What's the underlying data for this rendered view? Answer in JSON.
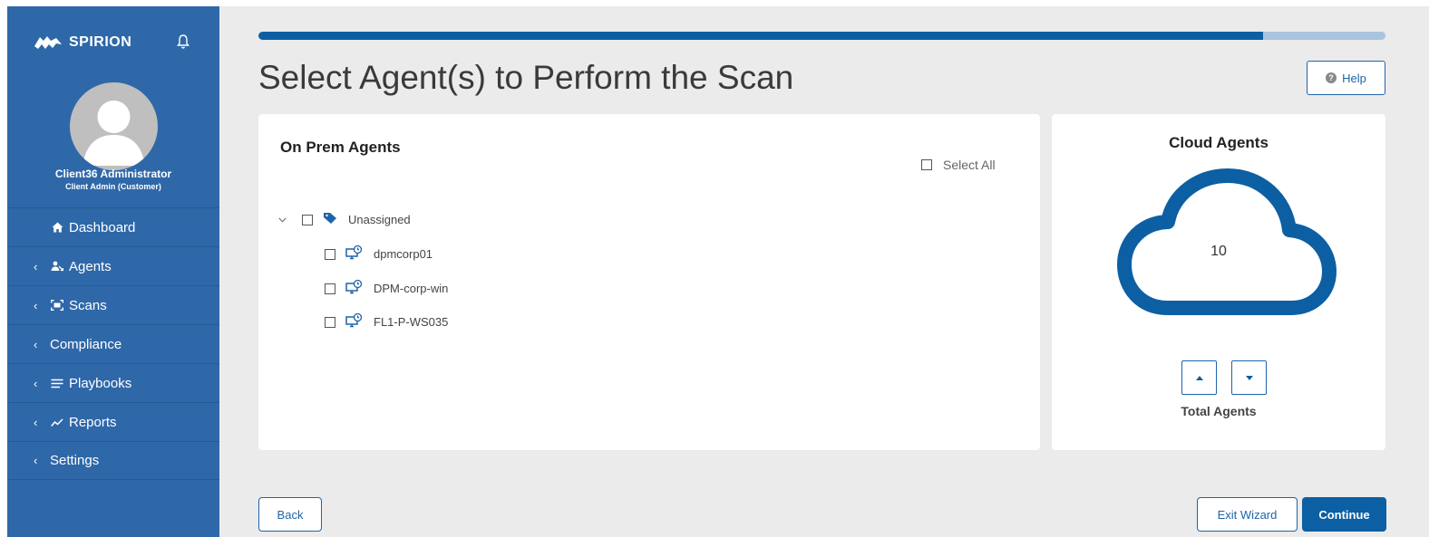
{
  "sidebar": {
    "brand": "SPIRION",
    "user_name": "Client36 Administrator",
    "user_role": "Client Admin (Customer)",
    "items": [
      {
        "label": "Dashboard",
        "icon": "home-icon",
        "chevron": false
      },
      {
        "label": "Agents",
        "icon": "agents-icon",
        "chevron": true
      },
      {
        "label": "Scans",
        "icon": "scan-icon",
        "chevron": true
      },
      {
        "label": "Compliance",
        "icon": "",
        "chevron": true
      },
      {
        "label": "Playbooks",
        "icon": "playbooks-icon",
        "chevron": true
      },
      {
        "label": "Reports",
        "icon": "reports-icon",
        "chevron": true
      },
      {
        "label": "Settings",
        "icon": "",
        "chevron": true
      }
    ]
  },
  "progress": {
    "fraction": 0.891
  },
  "page": {
    "title": "Select Agent(s) to Perform the Scan",
    "help_label": "Help"
  },
  "onprem": {
    "title": "On Prem Agents",
    "select_all": "Select All",
    "group": "Unassigned",
    "agents": [
      "dpmcorp01",
      "DPM-corp-win",
      "FL1-P-WS035"
    ]
  },
  "cloud": {
    "title": "Cloud Agents",
    "count": "10",
    "total_label": "Total Agents"
  },
  "footer": {
    "back": "Back",
    "exit": "Exit Wizard",
    "continue": "Continue"
  },
  "colors": {
    "sidebar": "#2f68a8",
    "accent": "#0c5fa3",
    "background": "#ebebeb"
  }
}
